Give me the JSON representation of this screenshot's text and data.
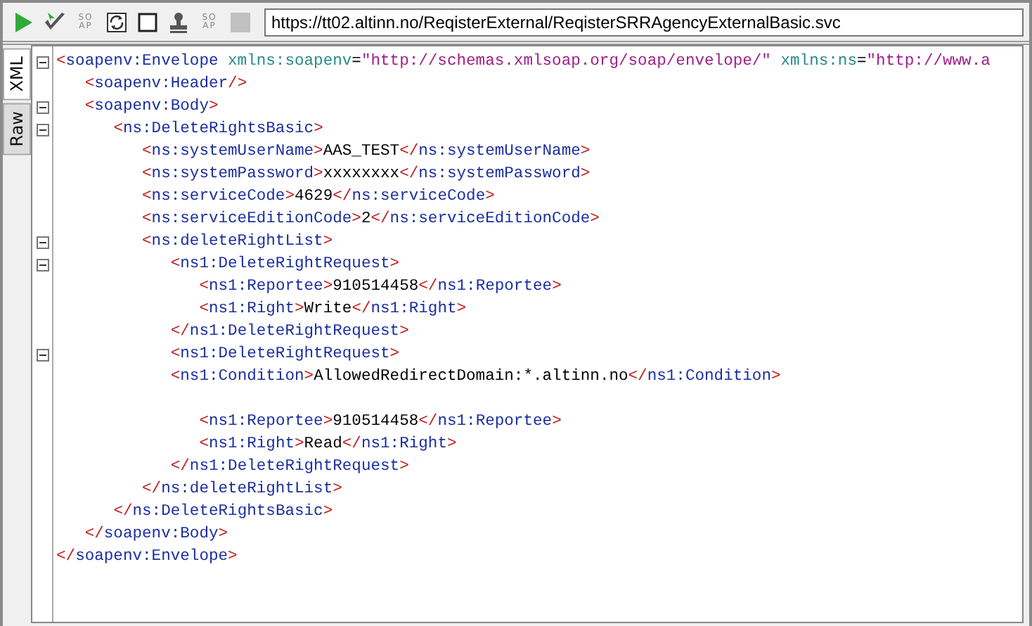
{
  "toolbar": [
    {
      "kind": "run",
      "disabled": false
    },
    {
      "kind": "validate",
      "disabled": false
    },
    {
      "kind": "soap",
      "label_top": "SO",
      "label_bottom": "AP",
      "disabled": false
    },
    {
      "kind": "refresh",
      "disabled": false
    },
    {
      "kind": "square",
      "disabled": false
    },
    {
      "kind": "stamp",
      "disabled": false
    },
    {
      "kind": "soap",
      "label_top": "SO",
      "label_bottom": "AP",
      "disabled": false
    },
    {
      "kind": "square",
      "disabled": true
    }
  ],
  "endpoint": {
    "value": "https://tt02.altinn.no/ReqisterExternal/ReqisterSRRAgencyExternalBasic.svc"
  },
  "side_tabs": [
    {
      "label": "XML",
      "selected": true
    },
    {
      "label": "Raw",
      "selected": false
    }
  ],
  "editor": {
    "lines": [
      {
        "text": "<soapenv:Envelope xmlns:soapenv=\"http://schemas.xmlsoap.org/soap/envelope/\" xmlns:ns=\"http://www.a",
        "kind": "foldable"
      },
      {
        "text": "   <soapenv:Header/>",
        "kind": "plain"
      },
      {
        "text": "   <soapenv:Body>",
        "kind": "foldable"
      },
      {
        "text": "      <ns:DeleteRightsBasic>",
        "kind": "foldable"
      },
      {
        "text": "         <ns:systemUserName>AAS_TEST</ns:systemUserName>",
        "kind": "plain"
      },
      {
        "text": "         <ns:systemPassword>xxxxxxxx</ns:systemPassword>",
        "kind": "plain"
      },
      {
        "text": "         <ns:serviceCode>4629</ns:serviceCode>",
        "kind": "plain"
      },
      {
        "text": "         <ns:serviceEditionCode>2</ns:serviceEditionCode>",
        "kind": "plain"
      },
      {
        "text": "         <ns:deleteRightList>",
        "kind": "foldable"
      },
      {
        "text": "            <ns1:DeleteRightRequest>",
        "kind": "foldable"
      },
      {
        "text": "               <ns1:Reportee>910514458</ns1:Reportee>",
        "kind": "plain"
      },
      {
        "text": "               <ns1:Right>Write</ns1:Right>",
        "kind": "plain"
      },
      {
        "text": "            </ns1:DeleteRightRequest>",
        "kind": "plain"
      },
      {
        "text": "            <ns1:DeleteRightRequest>",
        "kind": "foldable"
      },
      {
        "text": "            <ns1:Condition>AllowedRedirectDomain:*.altinn.no</ns1:Condition>",
        "kind": "plain"
      },
      {
        "kind": "blank"
      },
      {
        "text": "               <ns1:Reportee>910514458</ns1:Reportee>",
        "kind": "plain"
      },
      {
        "text": "               <ns1:Right>Read</ns1:Right>",
        "kind": "plain"
      },
      {
        "text": "            </ns1:DeleteRightRequest>",
        "kind": "plain"
      },
      {
        "text": "         </ns:deleteRightList>",
        "kind": "plain"
      },
      {
        "text": "      </ns:DeleteRightsBasic>",
        "kind": "plain"
      },
      {
        "text": "   </soapenv:Body>",
        "kind": "plain"
      },
      {
        "text": "</soapenv:Envelope>",
        "kind": "plain"
      }
    ]
  }
}
